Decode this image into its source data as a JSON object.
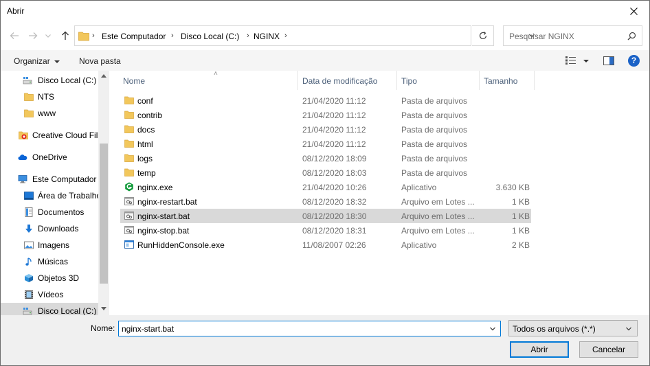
{
  "window": {
    "title": "Abrir"
  },
  "address": {
    "crumbs": [
      "Este Computador",
      "Disco Local (C:)",
      "NGINX"
    ]
  },
  "search": {
    "placeholder": "Pesquisar NGINX"
  },
  "toolbar": {
    "organize": "Organizar",
    "new_folder": "Nova pasta"
  },
  "sidebar": {
    "items": [
      {
        "label": "Disco Local (C:)",
        "icon": "drive-icon"
      },
      {
        "label": "NTS",
        "icon": "folder-icon"
      },
      {
        "label": "www",
        "icon": "folder-icon"
      },
      {
        "label": "Creative Cloud Fil",
        "icon": "creative-cloud-icon"
      },
      {
        "label": "OneDrive",
        "icon": "cloud-icon"
      },
      {
        "label": "Este Computador",
        "icon": "computer-icon"
      },
      {
        "label": "Área de Trabalho",
        "icon": "desktop-icon"
      },
      {
        "label": "Documentos",
        "icon": "documents-icon"
      },
      {
        "label": "Downloads",
        "icon": "download-icon"
      },
      {
        "label": "Imagens",
        "icon": "images-icon"
      },
      {
        "label": "Músicas",
        "icon": "music-icon"
      },
      {
        "label": "Objetos 3D",
        "icon": "cube-icon"
      },
      {
        "label": "Vídeos",
        "icon": "video-icon"
      },
      {
        "label": "Disco Local (C:)",
        "icon": "drive-icon"
      }
    ]
  },
  "columns": {
    "name": "Nome",
    "modified": "Data de modificação",
    "type": "Tipo",
    "size": "Tamanho"
  },
  "files": [
    {
      "name": "conf",
      "modified": "21/04/2020 11:12",
      "type": "Pasta de arquivos",
      "size": "",
      "icon": "folder-icon"
    },
    {
      "name": "contrib",
      "modified": "21/04/2020 11:12",
      "type": "Pasta de arquivos",
      "size": "",
      "icon": "folder-icon"
    },
    {
      "name": "docs",
      "modified": "21/04/2020 11:12",
      "type": "Pasta de arquivos",
      "size": "",
      "icon": "folder-icon"
    },
    {
      "name": "html",
      "modified": "21/04/2020 11:12",
      "type": "Pasta de arquivos",
      "size": "",
      "icon": "folder-icon"
    },
    {
      "name": "logs",
      "modified": "08/12/2020 18:09",
      "type": "Pasta de arquivos",
      "size": "",
      "icon": "folder-icon"
    },
    {
      "name": "temp",
      "modified": "08/12/2020 18:03",
      "type": "Pasta de arquivos",
      "size": "",
      "icon": "folder-icon"
    },
    {
      "name": "nginx.exe",
      "modified": "21/04/2020 10:26",
      "type": "Aplicativo",
      "size": "3.630 KB",
      "icon": "nginx-icon"
    },
    {
      "name": "nginx-restart.bat",
      "modified": "08/12/2020 18:32",
      "type": "Arquivo em Lotes ...",
      "size": "1 KB",
      "icon": "bat-icon"
    },
    {
      "name": "nginx-start.bat",
      "modified": "08/12/2020 18:30",
      "type": "Arquivo em Lotes ...",
      "size": "1 KB",
      "icon": "bat-icon"
    },
    {
      "name": "nginx-stop.bat",
      "modified": "08/12/2020 18:31",
      "type": "Arquivo em Lotes ...",
      "size": "1 KB",
      "icon": "bat-icon"
    },
    {
      "name": "RunHiddenConsole.exe",
      "modified": "11/08/2007 02:26",
      "type": "Aplicativo",
      "size": "2 KB",
      "icon": "app-icon"
    }
  ],
  "footer": {
    "name_label": "Nome:",
    "filename": "nginx-start.bat",
    "filter": "Todos os arquivos (*.*)",
    "open": "Abrir",
    "cancel": "Cancelar"
  },
  "colors": {
    "accent": "#0078d7",
    "folder": "#e8b838",
    "selection": "#d9d9d9"
  }
}
